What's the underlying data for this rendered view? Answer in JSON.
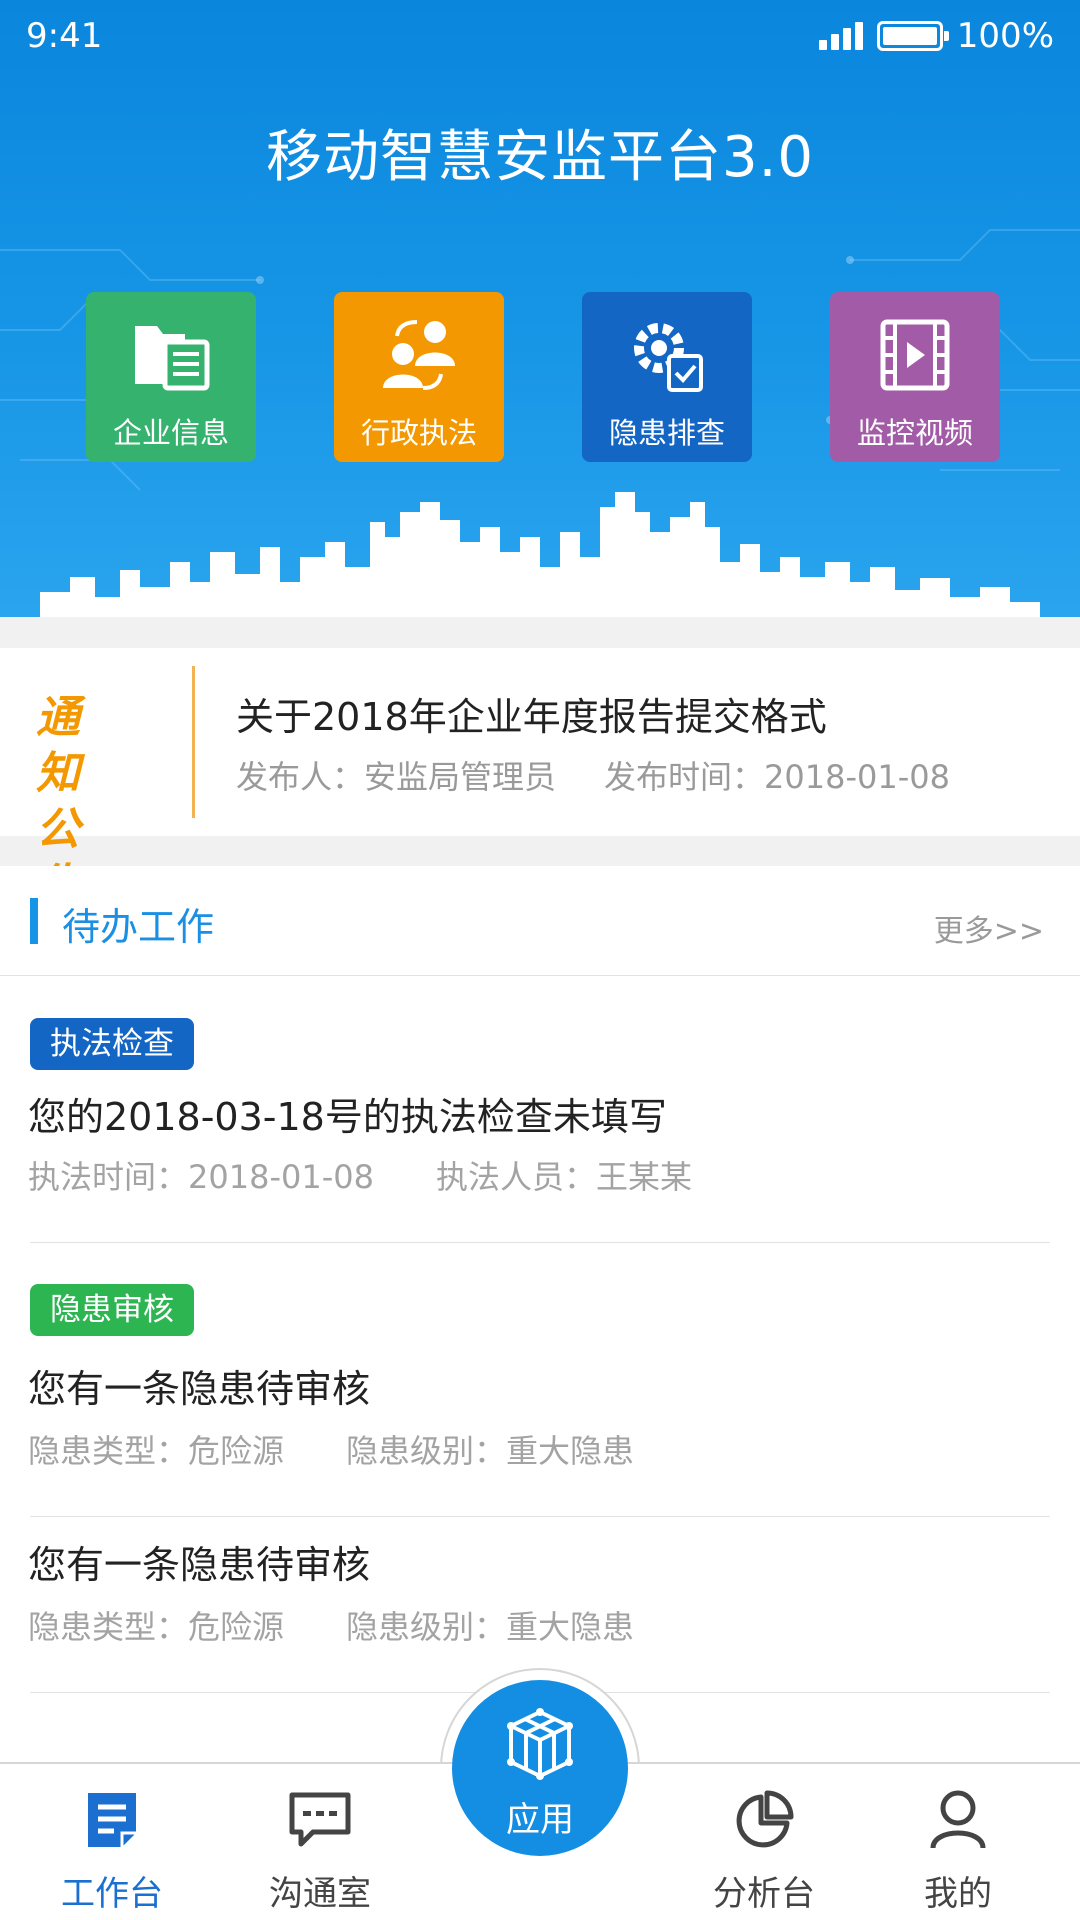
{
  "status_bar": {
    "time": "9:41",
    "battery": "100%"
  },
  "app": {
    "title": "移动智慧安监平台3.0"
  },
  "quick_tiles": [
    {
      "label": "企业信息",
      "icon": "folder-document-icon",
      "color": "#35b26e"
    },
    {
      "label": "行政执法",
      "icon": "people-exchange-icon",
      "color": "#f39800"
    },
    {
      "label": "隐患排查",
      "icon": "gear-checklist-icon",
      "color": "#1366c4"
    },
    {
      "label": "监控视频",
      "icon": "video-film-icon",
      "color": "#a25ba6"
    }
  ],
  "notice": {
    "badge_line1": "通 知",
    "badge_line2": "公 告",
    "title": "关于2018年企业年度报告提交格式",
    "publisher": "发布人：安监局管理员",
    "publish_time": "发布时间：2018-01-08"
  },
  "todo": {
    "section_title": "待办工作",
    "more": "更多>>",
    "items": [
      {
        "tag": "执法检查",
        "tag_color": "#1366c4",
        "title": "您的2018-03-18号的执法检查未填写",
        "meta1": "执法时间：2018-01-08",
        "meta2": "执法人员：王某某"
      },
      {
        "tag": "隐患审核",
        "tag_color": "#2cb551",
        "title": "您有一条隐患待审核",
        "meta1": "隐患类型：危险源",
        "meta2": "隐患级别：重大隐患"
      },
      {
        "title": "您有一条隐患待审核",
        "meta1": "隐患类型：危险源",
        "meta2": "隐患级别：重大隐患"
      }
    ]
  },
  "tabbar": {
    "tabs": [
      {
        "label": "工作台",
        "icon": "workbench-icon",
        "active": true
      },
      {
        "label": "沟通室",
        "icon": "chat-icon",
        "active": false
      },
      {
        "label": "分析台",
        "icon": "pie-chart-icon",
        "active": false
      },
      {
        "label": "我的",
        "icon": "user-icon",
        "active": false
      }
    ],
    "center": {
      "label": "应用",
      "icon": "cube-icon"
    }
  },
  "colors": {
    "primary": "#148ee3",
    "accent_orange": "#f39800"
  }
}
